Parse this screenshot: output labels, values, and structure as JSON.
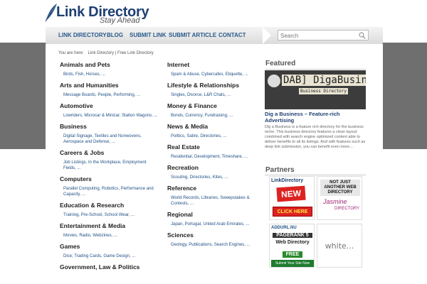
{
  "header": {
    "logo_title": "Link Directory",
    "logo_tagline": "Stay Ahead"
  },
  "nav": {
    "items": [
      "LINK DIRECTORY",
      "BLOG",
      "SUBMIT LINK",
      "SUBMIT ARTICLE",
      "CONTACT"
    ]
  },
  "search": {
    "placeholder": "Search"
  },
  "breadcrumb": {
    "prefix": "You are here:",
    "path": "Link Directory | Free Link Directory"
  },
  "categories_left": [
    {
      "title": "Animals and Pets",
      "subs": "Birds, Fish, Horses, ..."
    },
    {
      "title": "Arts and Humanities",
      "subs": "Message Boards, People, Performing, ..."
    },
    {
      "title": "Automotive",
      "subs": "Lowriders, Microcar & Minicar, Station Wagons, ..."
    },
    {
      "title": "Business",
      "subs": "Digital Signage, Textiles and Nonwovens, Aerospace and Defense, ..."
    },
    {
      "title": "Careers & Jobs",
      "subs": "Job Listings, In the Workplace, Employment Fields, ..."
    },
    {
      "title": "Computers",
      "subs": "Parallel Computing, Robotics, Performance and Capacity, ..."
    },
    {
      "title": "Education & Research",
      "subs": "Training, Pre-School, School Wear, ..."
    },
    {
      "title": "Entertainment & Media",
      "subs": "Movies, Radio, Webzines, ..."
    },
    {
      "title": "Games",
      "subs": "Dice, Trading Cards, Game Design, ..."
    },
    {
      "title": "Government, Law & Politics",
      "subs": ""
    }
  ],
  "categories_right": [
    {
      "title": "Internet",
      "subs": "Spam & Abuse, Cybercafes, Etiquette, ..."
    },
    {
      "title": "Lifestyle & Relationships",
      "subs": "Singles, Divorce, L&R Chats, ..."
    },
    {
      "title": "Money & Finance",
      "subs": "Bonds, Currency, Fundraising, ..."
    },
    {
      "title": "News & Media",
      "subs": "Politics, Satire, Directories, ..."
    },
    {
      "title": "Real Estate",
      "subs": "Residential, Development, Timeshare, ..."
    },
    {
      "title": "Recreation",
      "subs": "Scouting, Directories, Kites, ..."
    },
    {
      "title": "Reference",
      "subs": "World Records, Libraries, Sweepstakes & Contests, ..."
    },
    {
      "title": "Regional",
      "subs": "Japan, Portugal, United Arab Emirates, ..."
    },
    {
      "title": "Sciences",
      "subs": "Geology, Publications, Search Engines, ..."
    }
  ],
  "featured": {
    "heading": "Featured",
    "image_line1": "DAB] DigaBusiness.com",
    "image_line2": "Business Directory",
    "title": "Dig a Business – Feature-rich Advertising",
    "description": "Dig a Business is a feature rich directory for the business niche. This business directory features a clean layout combined with search engine optimized content able to deliver benefits to all its listings. And with features such as deep link submission, you can benefit even more...."
  },
  "partners": {
    "heading": "Partners",
    "p1": {
      "top": "LinkDirectory",
      "badge": "NEW",
      "cta": "CLICK HERE"
    },
    "p2": {
      "top": "NOT JUST ANOTHER WEB DIRECTORY",
      "logo": "Jasmine",
      "sub": "DIRECTORY"
    },
    "p3": {
      "top": "ADDURL.NU",
      "rank": "PAGERANK 5",
      "title": "Web Directory",
      "free": "FREE",
      "bottom": "Submit Your Site Now"
    },
    "p4": {
      "logo": "white..."
    }
  },
  "colors": {
    "accent": "#1f3f73",
    "link": "#1e4f86",
    "band": "#6f6f6f"
  }
}
